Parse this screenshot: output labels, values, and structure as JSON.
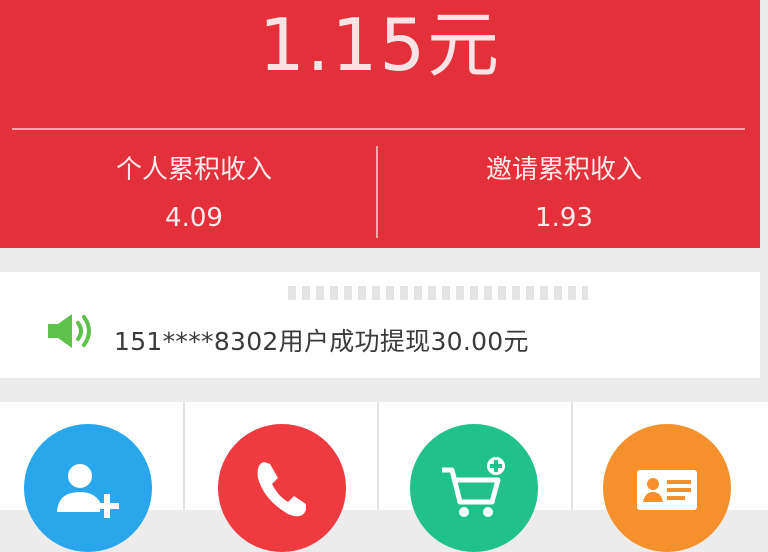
{
  "balance": {
    "amount": "1.15元"
  },
  "stats": {
    "personal": {
      "label": "个人累积收入",
      "value": "4.09"
    },
    "invite": {
      "label": "邀请累积收入",
      "value": "1.93"
    }
  },
  "notice": {
    "icon": "speaker-icon",
    "text": "151****8302用户成功提现30.00元"
  },
  "actions": [
    {
      "icon": "add-user-icon",
      "color": "#2aa7ec"
    },
    {
      "icon": "phone-icon",
      "color": "#ef3a40"
    },
    {
      "icon": "cart-add-icon",
      "color": "#20c18a"
    },
    {
      "icon": "id-card-icon",
      "color": "#f5912c"
    }
  ],
  "colors": {
    "brand_red": "#e4303a",
    "speaker_green": "#5cc24a"
  }
}
